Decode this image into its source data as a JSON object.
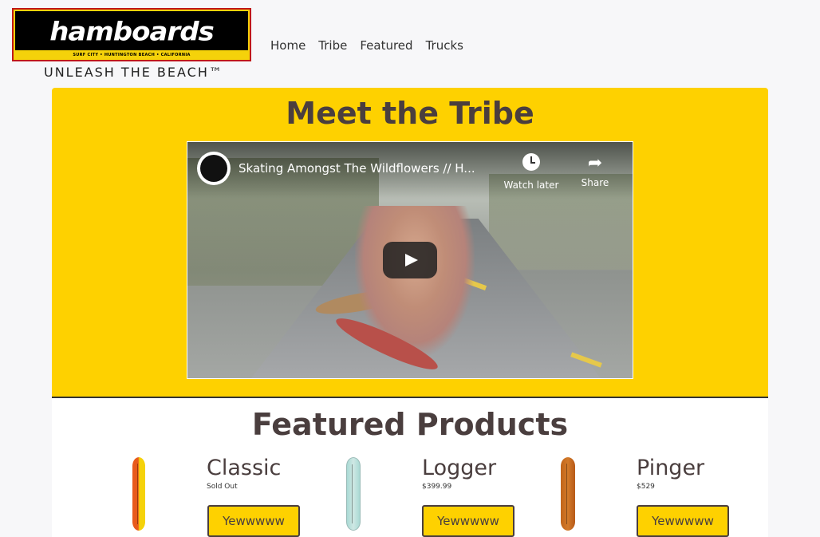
{
  "header": {
    "logo_text": "hamboards",
    "logo_subtext": "SURF CITY • HUNTINGTON BEACH • CALIFORNIA",
    "tagline": "UNLEASH THE BEACH™"
  },
  "nav": {
    "items": [
      {
        "label": "Home"
      },
      {
        "label": "Tribe"
      },
      {
        "label": "Featured"
      },
      {
        "label": "Trucks"
      }
    ]
  },
  "tribe": {
    "title": "Meet the Tribe",
    "video": {
      "title": "Skating Amongst The Wildflowers // H...",
      "watch_later_label": "Watch later",
      "share_label": "Share"
    }
  },
  "featured": {
    "title": "Featured Products",
    "products": [
      {
        "name": "Classic",
        "price": "Sold Out",
        "button": "Yewwwww"
      },
      {
        "name": "Logger",
        "price": "$399.99",
        "button": "Yewwwww"
      },
      {
        "name": "Pinger",
        "price": "$529",
        "button": "Yewwwww"
      }
    ]
  },
  "colors": {
    "accent": "#fed100",
    "text": "#4a3e3e"
  }
}
